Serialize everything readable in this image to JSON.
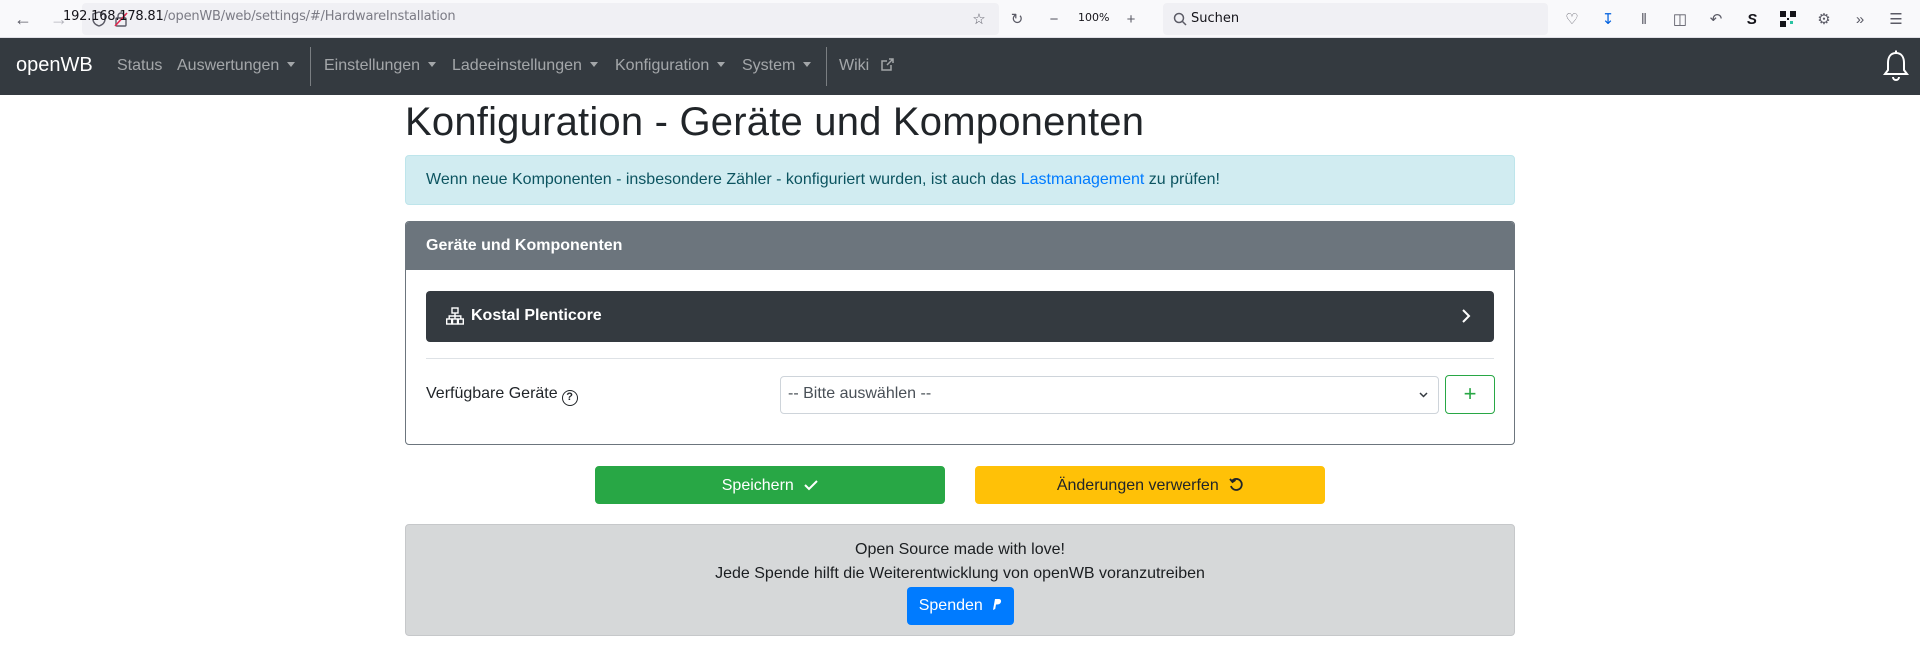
{
  "browser": {
    "url_host": "192.168.178.81",
    "url_path": "/openWB/web/settings/#/HardwareInstallation",
    "zoom": "100%",
    "search_placeholder": "Suchen"
  },
  "navbar": {
    "brand": "openWB",
    "items": [
      {
        "label": "Status",
        "dropdown": false
      },
      {
        "label": "Auswertungen",
        "dropdown": true
      },
      {
        "label": "Einstellungen",
        "dropdown": true
      },
      {
        "label": "Ladeeinstellungen",
        "dropdown": true
      },
      {
        "label": "Konfiguration",
        "dropdown": true
      },
      {
        "label": "System",
        "dropdown": true
      },
      {
        "label": "Wiki",
        "dropdown": false
      }
    ]
  },
  "page": {
    "title": "Konfiguration - Geräte und Komponenten",
    "alert": {
      "text_before": "Wenn neue Komponenten - insbesondere Zähler - konfiguriert wurden, ist auch das ",
      "link": "Lastmanagement",
      "text_after": " zu prüfen!"
    },
    "card": {
      "header": "Geräte und Komponenten",
      "device": "Kostal Plenticore",
      "available_label": "Verfügbare Geräte",
      "select_value": "-- Bitte auswählen --",
      "add_label": "+"
    },
    "buttons": {
      "save": "Speichern",
      "discard": "Änderungen verwerfen"
    },
    "footer": {
      "line1": "Open Source made with love!",
      "line2": "Jede Spende hilft die Weiterentwicklung von openWB voranzutreiben",
      "donate": "Spenden"
    }
  },
  "colors": {
    "navbar_bg": "#343a40",
    "success": "#28a745",
    "warning": "#ffc107",
    "primary": "#007bff",
    "secondary": "#6c757d",
    "info_bg": "#d1ecf1"
  }
}
